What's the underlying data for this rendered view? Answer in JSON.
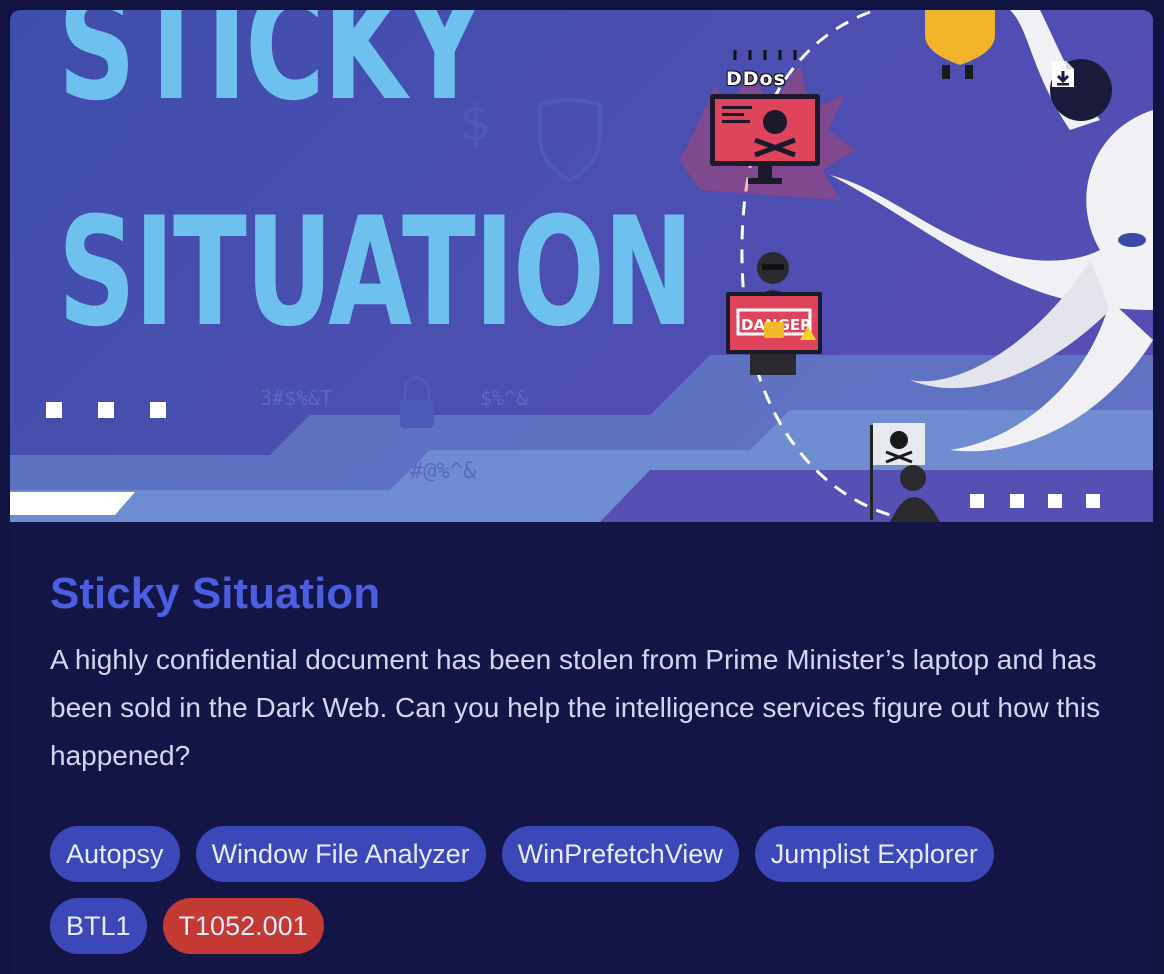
{
  "banner": {
    "title_line1": "STICKY",
    "title_line2": "SITUATION",
    "ddos_label": "DDos",
    "ransom_label": "DANGER",
    "glyph_text_1": "3#$%&T",
    "glyph_text_2": "#@%^&",
    "glyph_text_3": "$%^&"
  },
  "download_button": {
    "icon": "file-download-icon"
  },
  "challenge": {
    "title": "Sticky Situation",
    "description": "A highly confidential document has been stolen from Prime Minister’s laptop and has been sold in the Dark Web. Can you help the intelligence services figure out how this happened?"
  },
  "tags": {
    "row1": [
      "Autopsy",
      "Window File Analyzer",
      "WinPrefetchView",
      "Jumplist Explorer"
    ],
    "row2": [
      "BTL1",
      "T1052.001"
    ]
  },
  "colors": {
    "page_bg": "#10123f",
    "title": "#4c5ee0",
    "tag_blue": "#3d48b8",
    "tag_red": "#c23a32",
    "banner_text": "#6ec0ef"
  }
}
